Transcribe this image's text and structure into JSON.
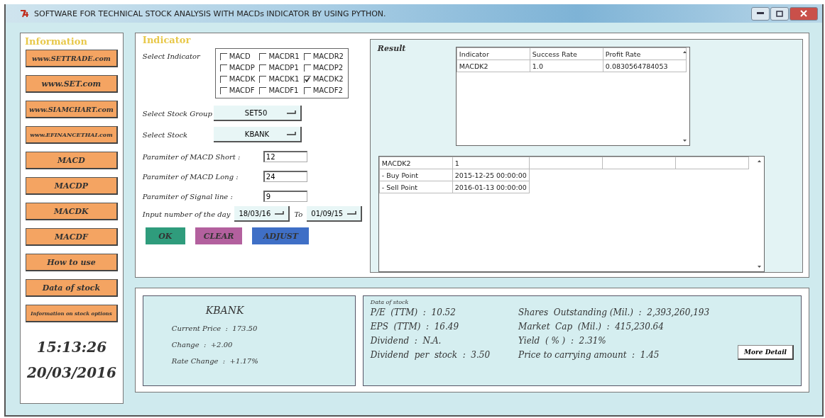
{
  "window": {
    "title": "SOFTWARE FOR TECHNICAL STOCK ANALYSIS WITH MACDs INDICATOR BY USING PYTHON."
  },
  "information": {
    "heading": "Information",
    "links": [
      "www.SETTRADE.com",
      "www.SET.com",
      "www.SIAMCHART.com",
      "www.EFINANCETHAI.com",
      "MACD",
      "MACDP",
      "MACDK",
      "MACDF",
      "How to use",
      "Data of stock",
      "Information on stock options"
    ],
    "time": "15:13:26",
    "date": "20/03/2016"
  },
  "indicator": {
    "heading": "Indicator",
    "select_label": "Select Indicator",
    "checkboxes": [
      {
        "label": "MACD",
        "checked": false
      },
      {
        "label": "MACDR1",
        "checked": false
      },
      {
        "label": "MACDR2",
        "checked": false
      },
      {
        "label": "MACDP",
        "checked": false
      },
      {
        "label": "MACDP1",
        "checked": false
      },
      {
        "label": "MACDP2",
        "checked": false
      },
      {
        "label": "MACDK",
        "checked": false
      },
      {
        "label": "MACDK1",
        "checked": false
      },
      {
        "label": "MACDK2",
        "checked": true
      },
      {
        "label": "MACDF",
        "checked": false
      },
      {
        "label": "MACDF1",
        "checked": false
      },
      {
        "label": "MACDF2",
        "checked": false
      }
    ],
    "selects": [
      {
        "label": "Select Stock Group",
        "value": "SET50"
      },
      {
        "label": "Select Stock",
        "value": "KBANK"
      }
    ],
    "params": [
      {
        "label": "Paramiter of MACD Short :",
        "value": "12"
      },
      {
        "label": "Paramiter of MACD Long :",
        "value": "24"
      },
      {
        "label": "Paramiter of Signal line :",
        "value": "9"
      }
    ],
    "date_range": {
      "label": "Input number of the day",
      "from": "18/03/16",
      "to_label": "To",
      "to": "01/09/15"
    },
    "buttons": [
      {
        "label": "OK",
        "color": "#2f9c7c"
      },
      {
        "label": "CLEAR",
        "color": "#b3609e"
      },
      {
        "label": "ADJUST",
        "color": "#3f6fc6"
      }
    ]
  },
  "result": {
    "heading": "Result",
    "summary_table": {
      "columns": [
        "Indicator",
        "Success Rate",
        "Profit Rate"
      ],
      "rows": [
        [
          "MACDK2",
          "1.0",
          "0.0830564784053"
        ]
      ]
    },
    "detail_table": {
      "rows": [
        [
          "MACDK2",
          "1"
        ],
        [
          "- Buy Point",
          "2015-12-25 00:00:00"
        ],
        [
          "- Sell Point",
          "2016-01-13 00:00:00"
        ]
      ]
    }
  },
  "stock_summary": {
    "name": "KBANK",
    "lines": [
      "Current Price  :  173.50",
      "Change  :  +2.00",
      "Rate Change  :  +1.17%"
    ]
  },
  "stock_data": {
    "heading": "Data of stock",
    "left": [
      "P/E  (TTM)  :  10.52",
      "EPS  (TTM)  :  16.49",
      "Dividend  :  N.A.",
      "Dividend  per  stock  :  3.50"
    ],
    "right": [
      "Shares  Outstanding (Mil.)  :  2,393,260,193",
      "Market  Cap  (Mil.)  :  415,230.64",
      "Yield  ( % )  :  2.31%",
      "Price to carrying amount  :  1.45"
    ],
    "more_button": "More Detail"
  }
}
